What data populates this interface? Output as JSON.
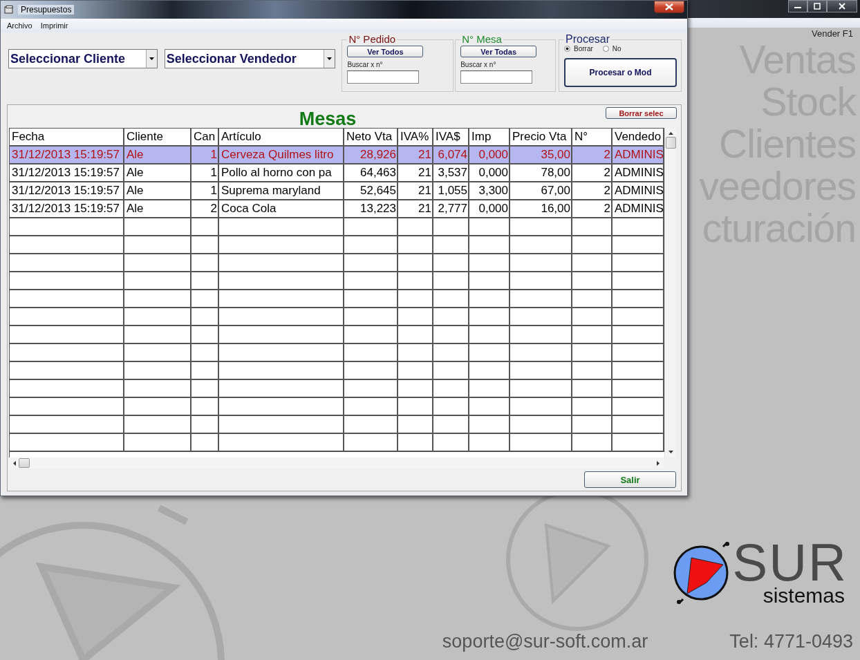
{
  "background_app": {
    "shortcut": "Vender F1",
    "menu_words": [
      "Ventas",
      "Stock",
      "Clientes",
      "veedores",
      "cturación"
    ],
    "logo": {
      "name": "SUR",
      "tagline": "sistemas"
    },
    "email": "soporte@sur-soft.com.ar",
    "phone": "Tel: 4771-0493"
  },
  "window": {
    "title": "Presupuestos",
    "menu": [
      "Archivo",
      "Imprimir"
    ],
    "client_select": {
      "value": "Seleccionar Cliente"
    },
    "seller_select": {
      "value": "Seleccionar Vendedor"
    },
    "groups": [
      {
        "title": "N° Pedido",
        "color": "#7a1212",
        "button": "Ver Todos",
        "search_label": "Buscar x  n°"
      },
      {
        "title": "N° Mesa",
        "color": "#1f8a2e",
        "button": "Ver Todas",
        "search_label": "Buscar x  n°"
      }
    ],
    "procesar": {
      "title": "Procesar",
      "options": [
        {
          "label": "Borrar",
          "selected": true
        },
        {
          "label": "No",
          "selected": false
        }
      ],
      "button": "Procesar o Mod"
    },
    "grid": {
      "title": "Mesas",
      "clear_button": "Borrar selec",
      "columns": [
        "Fecha",
        "Cliente",
        "Can",
        "Artículo",
        "Neto Vta",
        "IVA%",
        "IVA$",
        "Imp",
        "Precio Vta",
        "N°",
        "Vendedo"
      ],
      "rows": [
        {
          "selected": true,
          "cells": [
            "31/12/2013 15:19:57",
            "Ale",
            "1",
            "Cerveza Quilmes litro",
            "28,926",
            "21",
            "6,074",
            "0,000",
            "35,00",
            "2",
            "ADMINIS"
          ]
        },
        {
          "selected": false,
          "cells": [
            "31/12/2013 15:19:57",
            "Ale",
            "1",
            "Pollo al horno con pa",
            "64,463",
            "21",
            "3,537",
            "0,000",
            "78,00",
            "2",
            "ADMINIS"
          ]
        },
        {
          "selected": false,
          "cells": [
            "31/12/2013 15:19:57",
            "Ale",
            "1",
            "Suprema maryland",
            "52,645",
            "21",
            "1,055",
            "3,300",
            "67,00",
            "2",
            "ADMINIS"
          ]
        },
        {
          "selected": false,
          "cells": [
            "31/12/2013 15:19:57",
            "Ale",
            "2",
            "Coca Cola",
            "13,223",
            "21",
            "2,777",
            "0,000",
            "16,00",
            "2",
            "ADMINIS"
          ]
        }
      ]
    },
    "exit_button": "Salir"
  }
}
